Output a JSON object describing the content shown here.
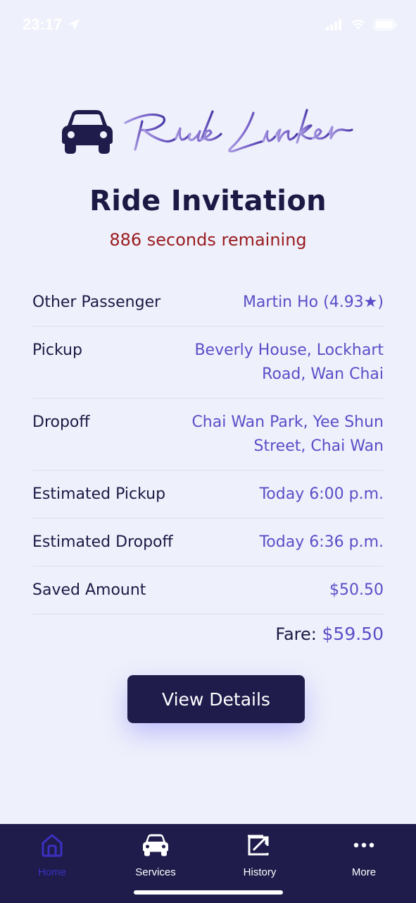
{
  "status_bar": {
    "time": "23:17"
  },
  "logo": {
    "text": "Ride Linker"
  },
  "page": {
    "title": "Ride Invitation",
    "countdown": "886 seconds remaining"
  },
  "details": [
    {
      "label": "Other Passenger",
      "value": "Martin Ho (4.93★)"
    },
    {
      "label": "Pickup",
      "value": "Beverly House, Lockhart Road, Wan Chai"
    },
    {
      "label": "Dropoff",
      "value": "Chai Wan Park, Yee Shun Street, Chai Wan"
    },
    {
      "label": "Estimated Pickup",
      "value": "Today 6:00 p.m."
    },
    {
      "label": "Estimated Dropoff",
      "value": "Today 6:36 p.m."
    },
    {
      "label": "Saved Amount",
      "value": "$50.50"
    }
  ],
  "fare": {
    "label": "Fare:",
    "amount": "$59.50"
  },
  "actions": {
    "view_details": "View Details"
  },
  "tabbar": {
    "active": "Home",
    "tabs": [
      {
        "label": "Home",
        "icon": "home-icon"
      },
      {
        "label": "Services",
        "icon": "car-icon"
      },
      {
        "label": "History",
        "icon": "history-icon"
      },
      {
        "label": "More",
        "icon": "more-icon"
      }
    ]
  },
  "colors": {
    "background": "#eef0fb",
    "primary_dark": "#1f1c4b",
    "accent": "#5a4ec8",
    "countdown_red": "#9a1b1f"
  }
}
